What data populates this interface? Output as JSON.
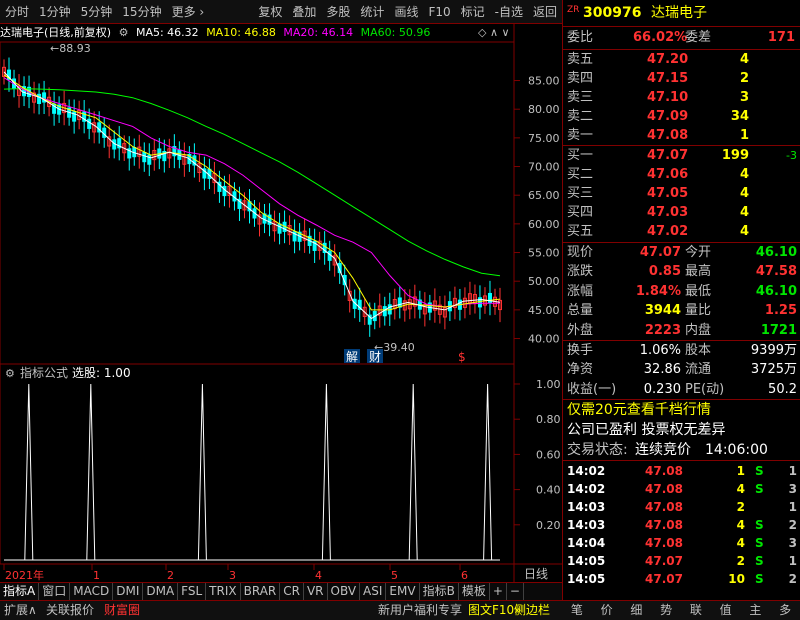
{
  "toolbar": {
    "items": [
      "分时",
      "1分钟",
      "5分钟",
      "15分钟",
      "更多",
      "复权",
      "叠加",
      "多股",
      "统计",
      "画线",
      "F10",
      "标记",
      "-自选",
      "返回"
    ]
  },
  "chart": {
    "title": "达瑞电子(日线,前复权)",
    "ma5": "MA5: 46.32",
    "ma10": "MA10: 46.88",
    "ma20": "MA20: 46.14",
    "ma60": "MA60: 50.96",
    "high_marker": "88.93",
    "low_marker": "39.40",
    "annot_1": "解",
    "annot_2": "财",
    "annot_3": "$",
    "price_ticks": [
      "85.00",
      "80.00",
      "75.00",
      "70.00",
      "65.00",
      "60.00",
      "55.00",
      "50.00",
      "45.00",
      "40.00"
    ],
    "indicator_title": "指标公式",
    "indicator_value": "选股: 1.00",
    "ind_ticks": [
      "1.00",
      "0.80",
      "0.60",
      "0.40",
      "0.20"
    ],
    "time_labels": [
      "2021年",
      "1",
      "2",
      "3",
      "4",
      "5",
      "6"
    ],
    "period": "日线",
    "colors": {
      "ma5": "#ffffff",
      "ma10": "#ffff00",
      "ma20": "#ff00ff",
      "ma60": "#00ff00",
      "up": "#ff3232",
      "down": "#00ffff"
    }
  },
  "chart_data": {
    "type": "line",
    "title": "",
    "series": [
      {
        "name": "MA60",
        "values": [
          83.5,
          83.6,
          83.5,
          83.4,
          83.2,
          83.0,
          82.6,
          82.0,
          81.0,
          79.8,
          78.5,
          77.0,
          75.6,
          74.0,
          72.4,
          70.8,
          69.0,
          67.0,
          65.0,
          63.0,
          61.0,
          59.0,
          57.0,
          55.3,
          53.8,
          52.5,
          51.4,
          50.96
        ]
      },
      {
        "name": "MA20",
        "values": [
          85.5,
          83.5,
          82.0,
          81.0,
          80.0,
          79.0,
          78.0,
          77.0,
          75.0,
          73.5,
          72.5,
          72.0,
          70.5,
          68.5,
          66.0,
          63.5,
          61.5,
          59.8,
          58.0,
          56.8,
          55.0,
          51.0,
          47.5,
          46.0,
          45.5,
          46.0,
          46.14,
          46.14
        ]
      },
      {
        "name": "MA10",
        "values": [
          86.0,
          83.8,
          82.0,
          80.5,
          79.5,
          78.5,
          76.0,
          73.5,
          72.0,
          72.5,
          72.0,
          70.0,
          67.5,
          65.0,
          62.0,
          60.0,
          58.5,
          57.0,
          55.0,
          50.5,
          45.0,
          45.0,
          46.0,
          45.8,
          45.5,
          46.0,
          46.5,
          46.88
        ]
      },
      {
        "name": "MA5",
        "values": [
          86.5,
          83.0,
          82.0,
          80.0,
          79.0,
          77.0,
          74.0,
          72.5,
          71.5,
          72.5,
          71.5,
          69.0,
          66.0,
          63.5,
          61.0,
          59.5,
          58.0,
          56.5,
          54.0,
          46.5,
          43.5,
          45.5,
          46.3,
          45.5,
          45.0,
          46.5,
          46.8,
          46.32
        ]
      }
    ],
    "ylim": [
      38,
      88.93
    ],
    "annotations": [
      "88.93",
      "39.40"
    ],
    "indicator": {
      "name": "选股",
      "signals_at": [
        2,
        7,
        16,
        26,
        33,
        39
      ],
      "ylim": [
        0,
        1
      ]
    }
  },
  "quote": {
    "prefix": "ZR",
    "code": "300976",
    "name": "达瑞电子",
    "weibi_label": "委比",
    "weibi_value": "66.02%",
    "weicha_label": "委差",
    "weicha_value": "171",
    "asks": [
      {
        "label": "卖五",
        "price": "47.20",
        "vol": "4"
      },
      {
        "label": "卖四",
        "price": "47.15",
        "vol": "2"
      },
      {
        "label": "卖三",
        "price": "47.10",
        "vol": "3"
      },
      {
        "label": "卖二",
        "price": "47.09",
        "vol": "34"
      },
      {
        "label": "卖一",
        "price": "47.08",
        "vol": "1"
      }
    ],
    "bids": [
      {
        "label": "买一",
        "price": "47.07",
        "vol": "199",
        "chg": "-3"
      },
      {
        "label": "买二",
        "price": "47.06",
        "vol": "4",
        "chg": ""
      },
      {
        "label": "买三",
        "price": "47.05",
        "vol": "4",
        "chg": ""
      },
      {
        "label": "买四",
        "price": "47.03",
        "vol": "4",
        "chg": ""
      },
      {
        "label": "买五",
        "price": "47.02",
        "vol": "4",
        "chg": ""
      }
    ],
    "stats": [
      {
        "l1": "现价",
        "v1": "47.07",
        "l2": "今开",
        "v2": "46.10",
        "c1": "red",
        "c2": "green"
      },
      {
        "l1": "涨跌",
        "v1": "0.85",
        "l2": "最高",
        "v2": "47.58",
        "c1": "red",
        "c2": "red"
      },
      {
        "l1": "涨幅",
        "v1": "1.84%",
        "l2": "最低",
        "v2": "46.10",
        "c1": "red",
        "c2": "green"
      },
      {
        "l1": "总量",
        "v1": "3944",
        "l2": "量比",
        "v2": "1.25",
        "c1": "yellow",
        "c2": "red"
      },
      {
        "l1": "外盘",
        "v1": "2223",
        "l2": "内盘",
        "v2": "1721",
        "c1": "red",
        "c2": "green"
      }
    ],
    "stats2": [
      {
        "l1": "换手",
        "v1": "1.06%",
        "l2": "股本",
        "v2": "9399万"
      },
      {
        "l1": "净资",
        "v1": "32.86",
        "l2": "流通",
        "v2": "3725万"
      },
      {
        "l1": "收益(一)",
        "v1": "0.230",
        "l2": "PE(动)",
        "v2": "50.2"
      }
    ],
    "promo": "仅需20元查看千档行情",
    "company": "公司已盈利 投票权无差异",
    "status_label": "交易状态:",
    "status_value": "连续竞价",
    "status_time": "14:06:00",
    "ticks": [
      {
        "t": "14:02",
        "p": "47.08",
        "v": "1",
        "d": "S",
        "n": "1"
      },
      {
        "t": "14:02",
        "p": "47.08",
        "v": "4",
        "d": "S",
        "n": "3"
      },
      {
        "t": "14:03",
        "p": "47.08",
        "v": "2",
        "d": "",
        "n": "1"
      },
      {
        "t": "14:03",
        "p": "47.08",
        "v": "4",
        "d": "S",
        "n": "2"
      },
      {
        "t": "14:04",
        "p": "47.08",
        "v": "4",
        "d": "S",
        "n": "3"
      },
      {
        "t": "14:05",
        "p": "47.07",
        "v": "2",
        "d": "S",
        "n": "1"
      },
      {
        "t": "14:05",
        "p": "47.07",
        "v": "10",
        "d": "S",
        "n": "2"
      }
    ]
  },
  "tabs": [
    "指标A",
    "窗口",
    "MACD",
    "DMI",
    "DMA",
    "FSL",
    "TRIX",
    "BRAR",
    "CR",
    "VR",
    "OBV",
    "ASI",
    "EMV",
    "指标B",
    "模板",
    "+",
    "−"
  ],
  "bottom": {
    "left": [
      "扩展∧",
      "关联报价",
      "财富圈"
    ],
    "right": [
      "新用户福利专享",
      "图文F10",
      "侧边栏"
    ],
    "panel_tabs": [
      "笔",
      "价",
      "细",
      "势",
      "联",
      "值",
      "主",
      "多"
    ]
  }
}
